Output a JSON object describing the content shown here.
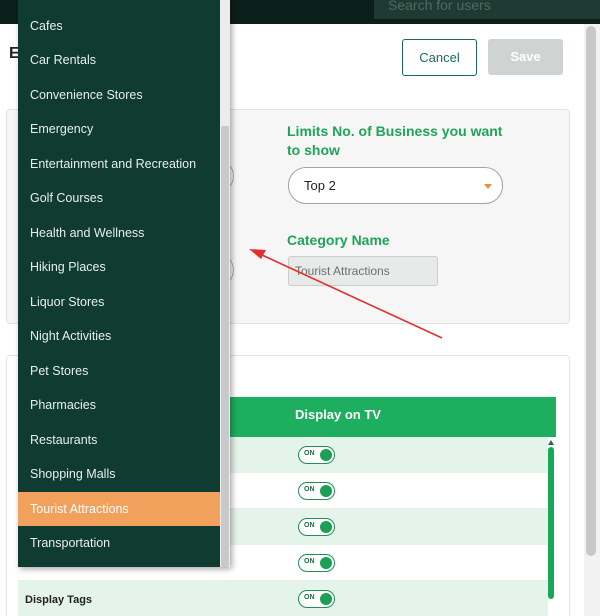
{
  "topbar": {
    "search_placeholder": "Search for users"
  },
  "header": {
    "title": "E",
    "cancel_label": "Cancel",
    "save_label": "Save"
  },
  "settings": {
    "limits_label": "Limits No. of Business you want to show",
    "limits_value": "Top 2",
    "category_label": "Category Name",
    "category_value": "Tourist Attractions"
  },
  "table": {
    "column_display": "Display on TV",
    "rows": [
      {
        "label": "",
        "toggle": "ON"
      },
      {
        "label": "",
        "toggle": "ON"
      },
      {
        "label": "",
        "toggle": "ON"
      },
      {
        "label": "",
        "toggle": "ON"
      },
      {
        "label": "Display Tags",
        "toggle": "ON"
      }
    ]
  },
  "dropdown": {
    "items": [
      "Cafes",
      "Car Rentals",
      "Convenience Stores",
      "Emergency",
      "Entertainment and Recreation",
      "Golf Courses",
      "Health and Wellness",
      "Hiking Places",
      "Liquor Stores",
      "Night Activities",
      "Pet Stores",
      "Pharmacies",
      "Restaurants",
      "Shopping Malls",
      "Tourist Attractions",
      "Transportation"
    ],
    "selected": "Tourist Attractions"
  },
  "colors": {
    "accent_green": "#1dae5f",
    "dropdown_bg": "#0f3b31",
    "selected_orange": "#f2a15d",
    "annotation_red": "#e03030"
  }
}
